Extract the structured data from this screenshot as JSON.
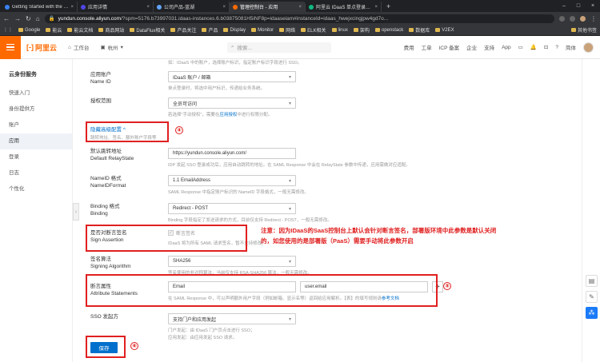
{
  "browser": {
    "tabs": [
      {
        "title": "Getting Started with the Conso",
        "color": "#3b82f6"
      },
      {
        "title": "应用详情",
        "color": "#4f46e5"
      },
      {
        "title": "公司产品-蓝湖",
        "color": "#60a5fa"
      },
      {
        "title": "管理控制台 - 应用",
        "color": "#ff6a00"
      },
      {
        "title": "阿里云 IDaaS 单点登录示例 - 语",
        "color": "#10b981"
      }
    ],
    "new_tab": "+",
    "url_host": "yundun.console.aliyun.com",
    "url_rest": "/?spm=5176.b73997031.idaas-instances.6.b03875081H5iNF8p=idaaseiam#instanceId=idaas_hwejxcingjpw4gd7o...",
    "bookmarks": [
      "Google",
      "能云",
      "能云文档",
      "商品网站",
      "DataFlux相关",
      "产品关注",
      "产品",
      "Display",
      "Monitor",
      "网络",
      "ELK相关",
      "linux",
      "架构",
      "openstack",
      "数据库",
      "V2EX"
    ],
    "bookmarks_right": "其他书签"
  },
  "console": {
    "logo_text": "阿里云",
    "workbench": "工作台",
    "region": "杭州",
    "search_placeholder": "搜索...",
    "nav": [
      "费用",
      "工单",
      "ICP 备案",
      "企业",
      "支持",
      "App"
    ],
    "lang": "简体"
  },
  "sidebar": {
    "title": "云身份服务",
    "items": [
      {
        "label": "快速入门",
        "active": false
      },
      {
        "label": "身份提供方",
        "active": false
      },
      {
        "label": "账户",
        "active": false
      },
      {
        "label": "应用",
        "active": true
      },
      {
        "label": "登录",
        "active": false
      },
      {
        "label": "日志",
        "active": false
      },
      {
        "label": "个性化",
        "active": false
      }
    ]
  },
  "form": {
    "top_hint": "如：IDaaS 中的账户，选择账户标识，指定账户标识字段进行 SSO。",
    "name_id": {
      "label1": "应用账户",
      "label2": "Name ID",
      "value": "IDaaS 账户 / 邮箱",
      "hint": "单点登录时，将选中用户标识，传递给业务系统。"
    },
    "scope": {
      "label": "授权范围",
      "value": "全员可访问",
      "hint_prefix": "若选择\"手动授权\"，需要在",
      "hint_link": "应用授权",
      "hint_suffix": "中进行权限分配。"
    },
    "advanced": {
      "label": "隐藏高级配置",
      "hint": "跳转地址、签名、额外账户字段等"
    },
    "relay_state": {
      "label1": "默认跳转地址",
      "label2": "Default RelayState",
      "value": "https://yundun.console.aliyun.com/",
      "hint": "IDP 发起 SSO 登录成功后，应用自动跳转的地址。在 SAML Response 中会在 RelayState 参数中传递，应用需做对应适配。"
    },
    "name_id_format": {
      "label1": "NameID 格式",
      "label2": "NameIDFormat",
      "value": "1.1 EmailAddress",
      "hint": "SAML Response 中指定账户标识的 NameID 字段格式，一般无需修改。"
    },
    "binding": {
      "label1": "Binding 格式",
      "label2": "Binding",
      "value": "Redirect - POST",
      "hint": "Binding 字段指定了发送请求的方式，目前仅支持 Redirect - POST，一般无需修改。"
    },
    "sign_assertion": {
      "label1": "是否对断言签名",
      "label2": "Sign Assertion",
      "checkbox_label": "断言签名",
      "hint": "IDaaS 将为所有 SAML 请求签名，暂不支持修改。"
    },
    "signing_algorithm": {
      "label1": "签名算法",
      "label2": "Signing Algorithm",
      "value": "SHA256",
      "hint": "签名使用的非对称算法，当前仅支持 RSA-SHA256 算法，一般无需修改。"
    },
    "attributes": {
      "label1": "断言属性",
      "label2": "Attribute Statements",
      "name_value": "Email",
      "value_value": "user.email",
      "plus": "+",
      "hint_prefix": "在 SAML Response 中，可以声明额外用户字段（例如邮箱、显示名等）返回给应用解析。【表】的填写规则请",
      "hint_link": "参考文档"
    },
    "sso_initiator": {
      "label": "SSO 发起方",
      "value": "支持门户和应用发起",
      "hint1": "门户发起：由 IDaaS 门户页点击进行 SSO；",
      "hint2": "应用发起：由应用发起 SSO 请求。"
    },
    "save": "保存"
  },
  "annotations": {
    "n4": "④",
    "n5": "⑤",
    "n6": "⑥",
    "note": "注意：因为IDaaS的SaaS控制台上默认会针对断言签名，部署版环境中此参数是默认关闭的，如您使用的是部署版（PaaS）需要手动将此参数开启"
  },
  "colors": {
    "accent": "#ff6a00",
    "link": "#0070cc",
    "annotation": "#e02020"
  }
}
